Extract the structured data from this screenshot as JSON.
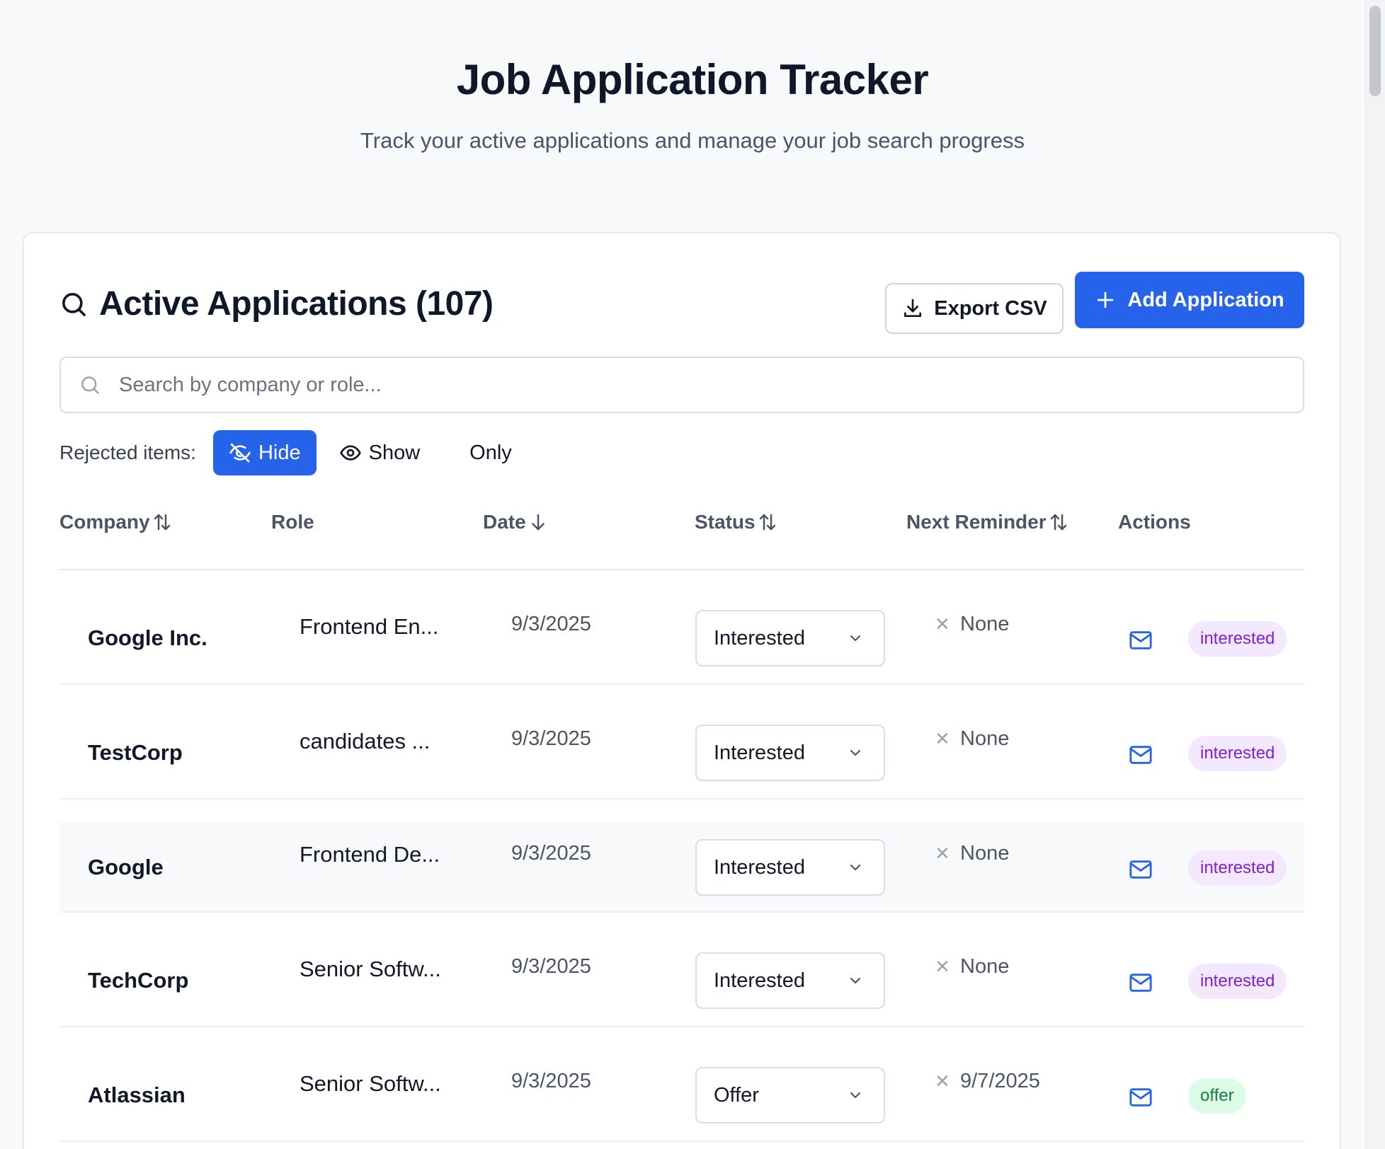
{
  "header": {
    "title": "Job Application Tracker",
    "subtitle": "Track your active applications and manage your job search progress"
  },
  "card": {
    "title": "Active Applications (107)",
    "export_label": "Export CSV",
    "add_label": "Add Application"
  },
  "search": {
    "placeholder": "Search by company or role..."
  },
  "filters": {
    "label": "Rejected items:",
    "hide": "Hide",
    "show": "Show",
    "only": "Only",
    "selected": "Hide"
  },
  "table": {
    "columns": [
      "Company",
      "Role",
      "Date",
      "Status",
      "Next Reminder",
      "Actions"
    ],
    "rows": [
      {
        "company": "Google Inc.",
        "role": "Frontend En...",
        "date": "9/3/2025",
        "status": "Interested",
        "reminder": "None",
        "badge": "interested"
      },
      {
        "company": "TestCorp",
        "role": "candidates ...",
        "date": "9/3/2025",
        "status": "Interested",
        "reminder": "None",
        "badge": "interested"
      },
      {
        "company": "Google",
        "role": "Frontend De...",
        "date": "9/3/2025",
        "status": "Interested",
        "reminder": "None",
        "badge": "interested"
      },
      {
        "company": "TechCorp",
        "role": "Senior Softw...",
        "date": "9/3/2025",
        "status": "Interested",
        "reminder": "None",
        "badge": "interested"
      },
      {
        "company": "Atlassian",
        "role": "Senior Softw...",
        "date": "9/3/2025",
        "status": "Offer",
        "reminder": "9/7/2025",
        "badge": "offer"
      }
    ]
  },
  "colors": {
    "accent": "#2563eb",
    "interested_bg": "#f3e8ff",
    "interested_fg": "#7e22ce",
    "offer_bg": "#dcfce7",
    "offer_fg": "#15803d"
  },
  "icons": {
    "title": "search-icon",
    "export": "download-icon",
    "add": "plus-icon",
    "hide": "eye-off-icon",
    "show": "eye-icon",
    "sort": "sort-arrows-icon",
    "sort_desc": "arrow-down-icon",
    "select": "chevron-down-icon",
    "clear": "x-icon",
    "email": "mail-icon"
  }
}
